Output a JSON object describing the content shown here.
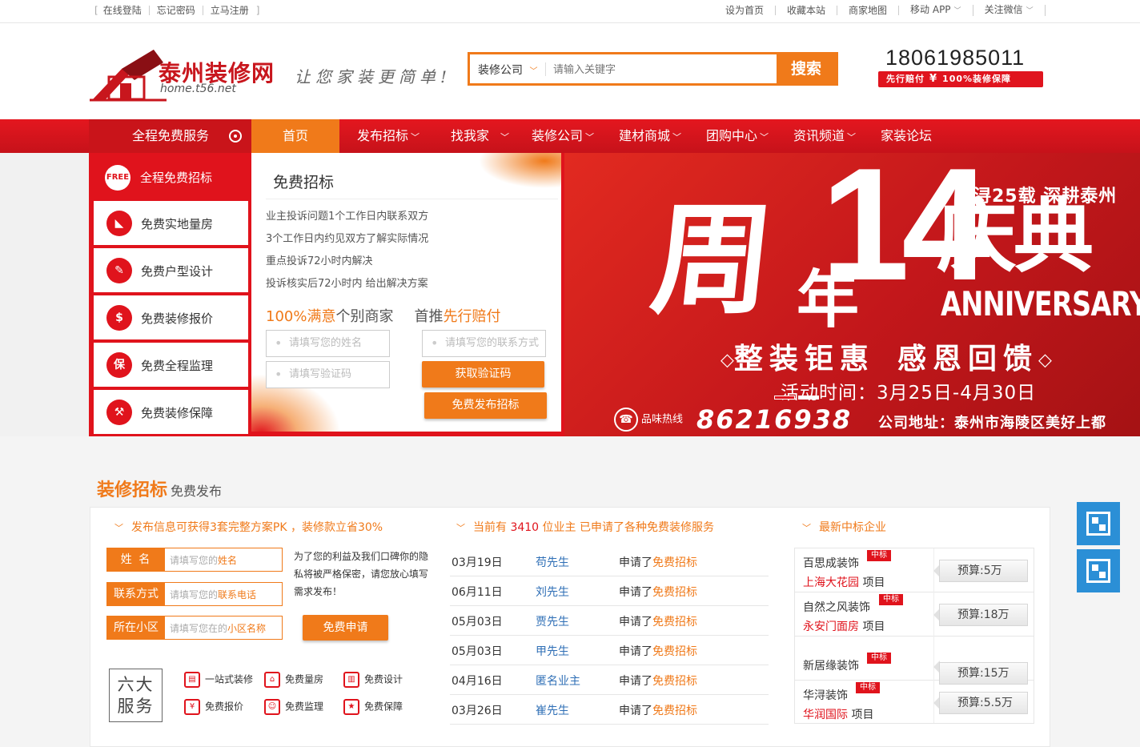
{
  "topbar": {
    "left_links": [
      "在线登陆",
      "忘记密码",
      "立马注册"
    ],
    "right_links": [
      "设为首页",
      "收藏本站",
      "商家地图",
      "移动 APP",
      "关注微信"
    ]
  },
  "header": {
    "logo_title": "泰州装修网",
    "logo_domain": "home.t56.net",
    "slogan": "让您家装更简单!",
    "search_category": "装修公司",
    "search_placeholder": "请输入关键字",
    "search_button": "搜索",
    "phone": "18061985011",
    "phone_badge_left": "先行赔付",
    "phone_badge_yen": "¥",
    "phone_badge_right": "100%装修保障"
  },
  "nav": {
    "all_services": "全程免费服务",
    "home": "首页",
    "items": [
      {
        "label": "发布招标",
        "dropdown": true
      },
      {
        "label": "找我家",
        "dropdown": true
      },
      {
        "label": "装修公司",
        "dropdown": true
      },
      {
        "label": "建材商城",
        "dropdown": true
      },
      {
        "label": "团购中心",
        "dropdown": true
      },
      {
        "label": "资讯频道",
        "dropdown": true
      },
      {
        "label": "家装论坛",
        "dropdown": false
      }
    ]
  },
  "side_menu": {
    "head_icon": "FREE",
    "head_label": "全程免费招标",
    "items": [
      {
        "label": "免费实地量房",
        "icon": "measure-icon",
        "glyph": "◣"
      },
      {
        "label": "免费户型设计",
        "icon": "design-icon",
        "glyph": "✎"
      },
      {
        "label": "免费装修报价",
        "icon": "money-bag-icon",
        "glyph": "$"
      },
      {
        "label": "免费全程监理",
        "icon": "guarantee-icon",
        "glyph": "保"
      },
      {
        "label": "免费装修保障",
        "icon": "gavel-icon",
        "glyph": "⚒"
      }
    ]
  },
  "form_panel": {
    "title": "免费招标",
    "desc": [
      "业主投诉问题1个工作日内联系双方",
      "3个工作日内约见双方了解实际情况",
      "重点投诉72小时内解决",
      "投诉核实后72小时内 给出解决方案"
    ],
    "promo_a1": "100%满意",
    "promo_a2": "个别商家",
    "promo_b1": "首推",
    "promo_b2": "先行赔付",
    "name_placeholder": "请填写您的姓名",
    "contact_placeholder": "请填写您的联系方式",
    "code_placeholder": "请填写验证码",
    "get_code_button": "获取验证码",
    "publish_button": "免费发布招标"
  },
  "slide": {
    "headline_a": "周",
    "headline_num": "14",
    "headline_b": "年",
    "headline_c": "庆典",
    "brand_line": "华浔25载 深耕泰州",
    "anniversary": "ANNIVERSARY",
    "phrase_1": "整装钜惠",
    "phrase_2": "感恩回馈",
    "activity": "活动时间：3月25日-4月30日",
    "hotline_label": "品味热线",
    "hotline_number": "86216938",
    "address": "公司地址：泰州市海陵区美好上都"
  },
  "section": {
    "title": "装修招标",
    "subtitle": "免费发布"
  },
  "apply": {
    "header": "发布信息可获得3套完整方案PK ，装修款立省30%",
    "name_label": "姓 名",
    "name_ph_a": "请填写您的",
    "name_ph_b": "姓名",
    "phone_label": "联系方式",
    "phone_ph_a": "请填写您的",
    "phone_ph_b": "联系电话",
    "area_label": "所在小区",
    "area_ph_a": "请填写您在的",
    "area_ph_b": "小区名称",
    "privacy": "为了您的利益及我们口碑你的隐私将被严格保密，请您放心填写需求发布！",
    "apply_button": "免费申请",
    "six_services_title": "六大服务",
    "services": [
      {
        "label": "一站式装修",
        "icon": "one-stop-icon",
        "glyph": "▤"
      },
      {
        "label": "免费量房",
        "icon": "house-measure-icon",
        "glyph": "⌂"
      },
      {
        "label": "免费设计",
        "icon": "free-design-icon",
        "glyph": "▥"
      },
      {
        "label": "免费报价",
        "icon": "quote-icon",
        "glyph": "¥"
      },
      {
        "label": "免费监理",
        "icon": "supervise-icon",
        "glyph": "☺"
      },
      {
        "label": "免费保障",
        "icon": "thumbs-up-icon",
        "glyph": "★"
      }
    ]
  },
  "records": {
    "header_a": "当前有",
    "header_count": "3410",
    "header_b": "位业主",
    "header_c": "已申请了各种",
    "header_d": "免费装修服务",
    "rows": [
      {
        "date": "03月19日",
        "name": "苟先生",
        "action_a": "申请了",
        "action_b": "免费招标"
      },
      {
        "date": "06月11日",
        "name": "刘先生",
        "action_a": "申请了",
        "action_b": "免费招标"
      },
      {
        "date": "05月03日",
        "name": "贾先生",
        "action_a": "申请了",
        "action_b": "免费招标"
      },
      {
        "date": "05月03日",
        "name": "甲先生",
        "action_a": "申请了",
        "action_b": "免费招标"
      },
      {
        "date": "04月16日",
        "name": "匿名业主",
        "action_a": "申请了",
        "action_b": "免费招标"
      },
      {
        "date": "03月26日",
        "name": "崔先生",
        "action_a": "申请了",
        "action_b": "免费招标"
      }
    ]
  },
  "winners": {
    "header": "最新中标企业",
    "badge": "中标",
    "project_suffix": "项目",
    "items": [
      {
        "company": "百思成装饰",
        "project": "上海大花园",
        "budget": "预算:5万"
      },
      {
        "company": "自然之风装饰",
        "project": "永安门面房",
        "budget": "预算:18万"
      },
      {
        "company": "新居缘装饰",
        "project": "",
        "budget": "预算:15万"
      },
      {
        "company": "华浔装饰",
        "project": "华润国际",
        "budget": "预算:5.5万"
      }
    ]
  }
}
